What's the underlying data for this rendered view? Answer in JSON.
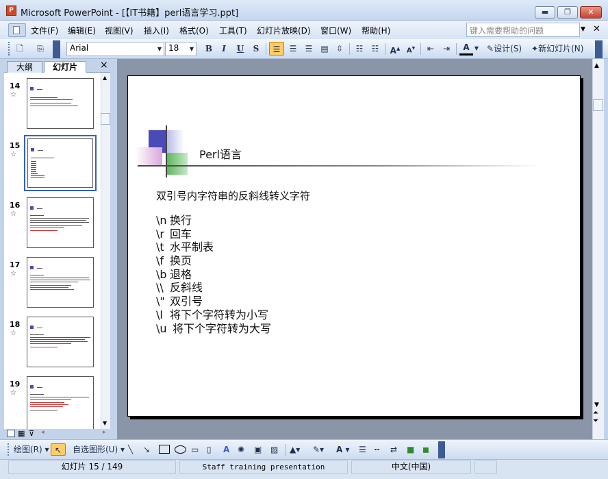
{
  "window": {
    "title": "Microsoft PowerPoint - [【IT书籍】perl语言学习.ppt]",
    "app_icon_glyph": "P",
    "min_glyph": "▬",
    "max_glyph": "❐",
    "close_glyph": "✕"
  },
  "menu": {
    "items": [
      "文件(F)",
      "编辑(E)",
      "视图(V)",
      "插入(I)",
      "格式(O)",
      "工具(T)",
      "幻灯片放映(D)",
      "窗口(W)",
      "帮助(H)"
    ],
    "help_placeholder": "键入需要帮助的问题"
  },
  "toolbar": {
    "font_name": "Arial",
    "font_size": "18",
    "bold": "B",
    "italic": "I",
    "underline": "U",
    "shadow": "S",
    "grow_font": "A",
    "shrink_font": "A",
    "font_color": "A",
    "design_label": "设计(S)",
    "new_slide_label": "新幻灯片(N)"
  },
  "pane": {
    "tab_outline": "大纲",
    "tab_slides": "幻灯片",
    "close_glyph": "×",
    "slide_numbers": [
      "14",
      "15",
      "16",
      "17",
      "18",
      "19"
    ],
    "star_glyph": "☆"
  },
  "slide": {
    "title": "Perl语言",
    "heading": "双引号内字符串的反斜线转义字符",
    "escapes": [
      {
        "code": "\\n",
        "desc": "换行"
      },
      {
        "code": "\\r",
        "desc": "回车"
      },
      {
        "code": "\\t",
        "desc": "水平制表"
      },
      {
        "code": "\\f",
        "desc": "换页"
      },
      {
        "code": "\\b",
        "desc": "退格"
      },
      {
        "code": "\\\\",
        "desc": "反斜线"
      },
      {
        "code": "\\\"",
        "desc": "双引号"
      },
      {
        "code": "\\l",
        "desc": "将下个字符转为小写"
      },
      {
        "code": "\\u",
        "desc": "将下个字符转为大写"
      }
    ],
    "colors": {
      "square_blue": "#4a4ab8",
      "square_green": "#5cb85c",
      "square_pink": "#d8a8d8"
    }
  },
  "drawing": {
    "draw_label": "绘图(R)",
    "autoshape_label": "自选图形(U)"
  },
  "status": {
    "slide_position": "幻灯片 15 / 149",
    "design_name": "Staff training presentation",
    "language": "中文(中国)"
  }
}
